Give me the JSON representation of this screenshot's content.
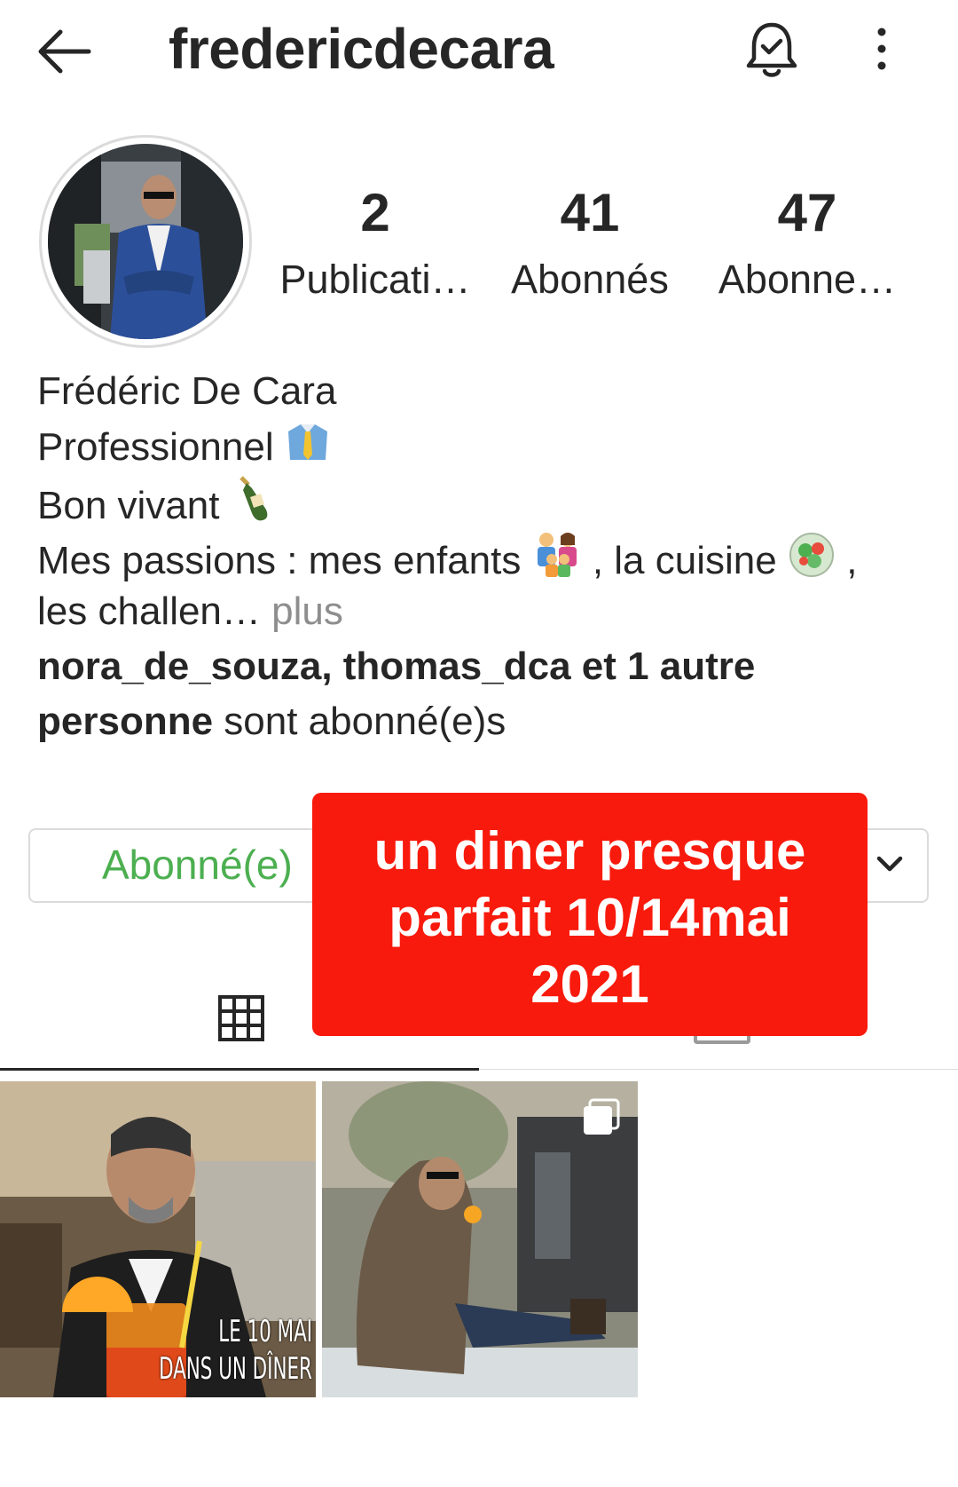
{
  "header": {
    "username": "fredericdecara",
    "back_icon": "arrow-left-icon",
    "notify_icon": "bell-check-icon",
    "more_icon": "vertical-dots-icon"
  },
  "profile": {
    "avatar": "profile-photo",
    "stats": [
      {
        "value": "2",
        "label": "Publicati…"
      },
      {
        "value": "41",
        "label": "Abonnés"
      },
      {
        "value": "47",
        "label": "Abonne…"
      }
    ]
  },
  "bio": {
    "name": "Frédéric De Cara",
    "line2": "Professionnel",
    "line3": "Bon vivant",
    "line4_a": "Mes passions : mes enfants",
    "line4_b": ", la cuisine",
    "line4_c": ",",
    "line5": "les challen…",
    "more": " plus",
    "followed_by_bold": "nora_de_souza, thomas_dca et 1 autre",
    "followed_by_bold2": "personne",
    "followed_by_rest": " sont abonné(e)s"
  },
  "actions": {
    "follow_label": "Abonné(e)",
    "dropdown_icon": "chevron-down-icon"
  },
  "banner": {
    "line1": "un diner presque",
    "line2": "parfait 10/14mai",
    "line3": "2021",
    "color": "#f81a0c"
  },
  "tabs": [
    {
      "icon": "grid-icon",
      "active": true
    },
    {
      "icon": "tagged-icon",
      "active": false
    }
  ],
  "posts": [
    {
      "caption_line1": "LE 10 MAI",
      "caption_line2": "DANS UN DÎNER"
    },
    {
      "multi_icon": "multiple-photos-icon"
    }
  ],
  "colors": {
    "text": "#262626",
    "follow_text": "#4caf50",
    "border": "#dbdbdb",
    "muted": "#8e8e8e"
  }
}
